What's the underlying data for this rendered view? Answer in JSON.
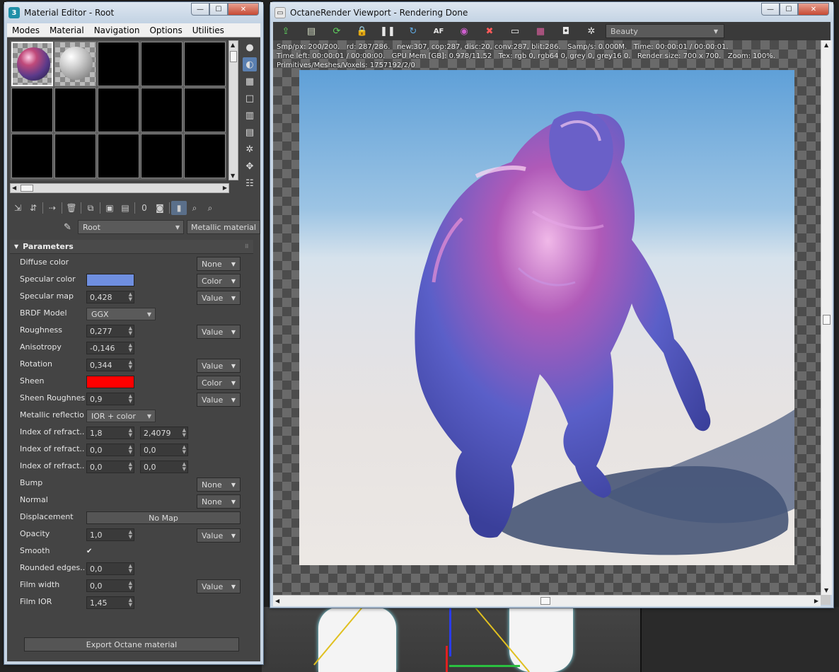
{
  "material_editor": {
    "title": "Material Editor - Root",
    "app_badge": "3",
    "menu": [
      "Modes",
      "Material",
      "Navigation",
      "Options",
      "Utilities"
    ],
    "material_name": "Root",
    "material_type": "Metallic material",
    "params_header": "Parameters",
    "params": [
      {
        "label": "Diffuse color",
        "kind": "map",
        "map": "None"
      },
      {
        "label": "Specular color",
        "kind": "color",
        "color": "#6f8fe0",
        "map": "Color"
      },
      {
        "label": "Specular map",
        "kind": "spin",
        "value": "0,428",
        "map": "Value"
      },
      {
        "label": "BRDF Model",
        "kind": "dropdown",
        "value": "GGX"
      },
      {
        "label": "Roughness",
        "kind": "spin",
        "value": "0,277",
        "map": "Value"
      },
      {
        "label": "Anisotropy",
        "kind": "spin",
        "value": "-0,146"
      },
      {
        "label": "Rotation",
        "kind": "spin",
        "value": "0,344",
        "map": "Value"
      },
      {
        "label": "Sheen",
        "kind": "color",
        "color": "#ff0000",
        "map": "Color"
      },
      {
        "label": "Sheen Roughness",
        "kind": "spin",
        "value": "0,9",
        "map": "Value"
      },
      {
        "label": "Metallic reflectio...",
        "kind": "dropdown",
        "value": "IOR + color"
      },
      {
        "label": "Index of refract...",
        "kind": "spin2",
        "value": "1,8",
        "value2": "2,4079"
      },
      {
        "label": "Index of refract...",
        "kind": "spin2",
        "value": "0,0",
        "value2": "0,0"
      },
      {
        "label": "Index of refract...",
        "kind": "spin2",
        "value": "0,0",
        "value2": "0,0"
      },
      {
        "label": "Bump",
        "kind": "map",
        "map": "None"
      },
      {
        "label": "Normal",
        "kind": "map",
        "map": "None"
      },
      {
        "label": "Displacement",
        "kind": "nomap",
        "value": "No Map"
      },
      {
        "label": "Opacity",
        "kind": "spin",
        "value": "1,0",
        "map": "Value"
      },
      {
        "label": "Smooth",
        "kind": "check",
        "value": "✔"
      },
      {
        "label": "Rounded edges...",
        "kind": "spin",
        "value": "0,0"
      },
      {
        "label": "Film width",
        "kind": "spin",
        "value": "0,0",
        "map": "Value"
      },
      {
        "label": "Film IOR",
        "kind": "spin",
        "value": "1,45"
      }
    ],
    "export_button": "Export Octane material"
  },
  "octane": {
    "title": "OctaneRender Viewport - Rendering Done",
    "render_pass": "Beauty",
    "stats_line1": "Smp/px: 200/200.   rd: 287/286.   new:307, cop:287, disc:20, conv:287, blit:286.   Samp/s: 0.000M.   Time: 00:00:01 / 00:00:01.",
    "stats_line2": "Time left: 00:00:01 / 00:00:00.   GPU Mem [GB]: 0.978/11.52   Tex: rgb 0, rgb64 0, grey 0, grey16 0.   Render size: 700 x 700.   Zoom: 100%.",
    "stats_line3": "Primitives/Meshes/Voxels: 1757192/2/0"
  },
  "window_buttons": {
    "min": "—",
    "max": "☐",
    "close": "✕"
  }
}
